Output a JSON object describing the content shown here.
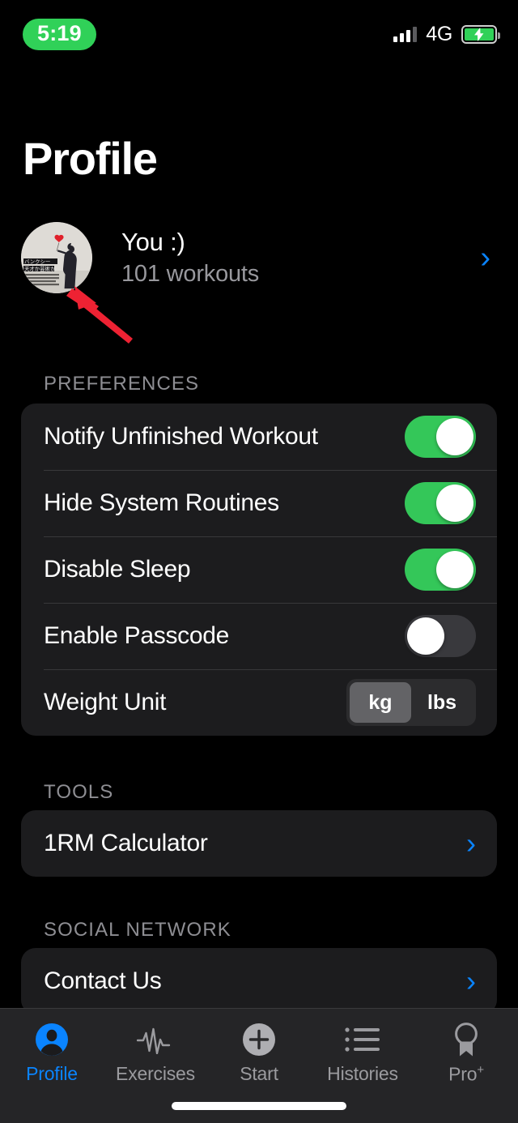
{
  "status_bar": {
    "time": "5:19",
    "time_pill_color": "#30D158",
    "network": "4G",
    "signal_bars_filled": 3,
    "signal_bars_total": 4,
    "battery_state": "charging",
    "battery_color": "#30D158"
  },
  "header": {
    "title": "Profile"
  },
  "profile": {
    "name": "You :)",
    "subtitle": "101 workouts",
    "chevron": "›",
    "avatar_alt": "banksy-newspaper-photo"
  },
  "annotation": {
    "type": "arrow",
    "color": "#EE2233",
    "points_to": "avatar"
  },
  "sections": [
    {
      "header": "PREFERENCES",
      "rows": [
        {
          "label": "Notify Unfinished Workout",
          "control": "toggle",
          "value": "on"
        },
        {
          "label": "Hide System Routines",
          "control": "toggle",
          "value": "on"
        },
        {
          "label": "Disable Sleep",
          "control": "toggle",
          "value": "on"
        },
        {
          "label": "Enable Passcode",
          "control": "toggle",
          "value": "off"
        },
        {
          "label": "Weight Unit",
          "control": "segmented",
          "options": [
            "kg",
            "lbs"
          ],
          "selected": "kg"
        }
      ]
    },
    {
      "header": "TOOLS",
      "rows": [
        {
          "label": "1RM Calculator",
          "control": "chevron",
          "chevron": "›"
        }
      ]
    },
    {
      "header": "SOCIAL NETWORK",
      "rows": [
        {
          "label": "Contact Us",
          "control": "chevron",
          "chevron": "›"
        }
      ]
    }
  ],
  "tab_bar": {
    "active": "Profile",
    "accent_color": "#0A84FF",
    "items": [
      {
        "label": "Profile",
        "icon": "person-circle-icon"
      },
      {
        "label": "Exercises",
        "icon": "pulse-waveform-icon"
      },
      {
        "label": "Start",
        "icon": "plus-circle-icon"
      },
      {
        "label": "Histories",
        "icon": "bulleted-list-icon"
      },
      {
        "label": "Pro",
        "icon": "award-ribbon-icon",
        "superscript": "+"
      }
    ]
  }
}
